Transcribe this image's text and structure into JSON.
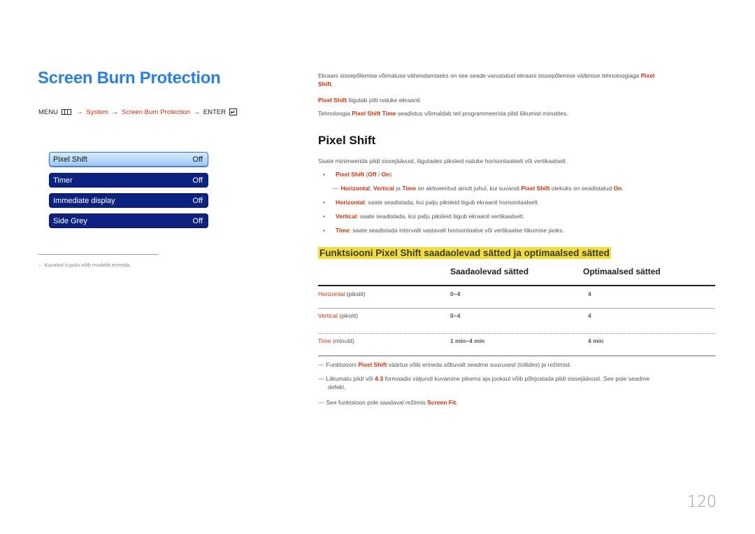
{
  "section_title": "Screen Burn Protection",
  "menu_path": {
    "menu_label": "MENU",
    "items": [
      "System",
      "Screen Burn Protection"
    ],
    "enter_label": "ENTER",
    "arrow": "→"
  },
  "osd_menu": [
    {
      "label": "Pixel Shift",
      "value": "Off",
      "selected": true
    },
    {
      "label": "Timer",
      "value": "Off",
      "selected": false
    },
    {
      "label": "Immediate display",
      "value": "Off",
      "selected": false
    },
    {
      "label": "Side Grey",
      "value": "Off",
      "selected": false
    }
  ],
  "left_footnote": "Kuvatud kujutis võib mudeliti erineda.",
  "left_footnote_dash": "–",
  "intro": {
    "p1_text": "Ekraani sissepõlemise võimaluse vähendamiseks on see seade varustatud ekraani sissepõlemise vältimise tehnoloogiaga ",
    "p1_term_a": "Pixel",
    "p1_term_b": "Shift",
    "p1_end": ".",
    "p2_term": "Pixel Shift",
    "p2_text": " liigutab pilti natuke ekraanil.",
    "p3_start": "Tehnoloogia ",
    "p3_term": "Pixel Shift Time",
    "p3_text": " seadistus võimaldab teil programmeerida pildi liikumist minutites."
  },
  "pixel_shift": {
    "heading": "Pixel Shift",
    "description": "Saate minimeerida pildi sissejäävust, liigutades piksleid natuke horisontaalselt või vertikaalselt.",
    "option_term": "Pixel Shift",
    "option_off": "Off",
    "option_on": "On",
    "note": {
      "t1": "Horizontal",
      "sep1": ", ",
      "t2": "Vertical",
      "sep2": " ja ",
      "t3": "Time",
      "text": " on aktiveeritud ainult juhul, kui suvandi ",
      "t4": "Pixel Shift",
      "text2": " olekuks on seadistatud ",
      "t5": "On",
      "end": "."
    },
    "bullets": [
      {
        "term": "Horizontal",
        "text": ": saate seadistada, kui palju piksleid liigub ekraanil horisontaalselt."
      },
      {
        "term": "Vertical",
        "text": ": saate seadistada, kui palju piksleid liigub ekraanil vertikaalselt."
      },
      {
        "term": "Time",
        "text": ": saate seadistada intervalli vastavalt horisontaalse või vertikaalse liikumise jaoks."
      }
    ]
  },
  "settings_table": {
    "title": "Funktsiooni Pixel Shift saadaolevad sätted ja optimaalsed sätted",
    "headers": [
      "",
      "Saadaolevad sätted",
      "Optimaalsed sätted"
    ],
    "rows": [
      {
        "term": "Horizontal",
        "unit": " (pikslit)",
        "available": "0~4",
        "optimal": "4"
      },
      {
        "term": "Vertical",
        "unit": " (pikslit)",
        "available": "0~4",
        "optimal": "4"
      },
      {
        "term": "Time",
        "unit": " (minutit)",
        "available": "1 min~4 min",
        "optimal": "4 min"
      }
    ]
  },
  "notes": [
    {
      "pre": "Funktsiooni ",
      "term": "Pixel Shift",
      "post": " väärtus võib erineda sõltuvalt seadme suurusest (tollides) ja režiimist."
    },
    {
      "pre": "Liikumatu pildi või ",
      "term": "4:3",
      "post": " formaadis väljundi kuvamine pikema aja jooksul võib põhjustada pildi sissejäävust. See pole seadme",
      "post2": "defekt."
    },
    {
      "pre": "See funktsioon pole saadaval režiimis ",
      "term": "Screen Fit",
      "post": "."
    }
  ],
  "page_number": "120",
  "colors": {
    "title_blue": "#2b7fe0",
    "term_red": "#c8320f",
    "highlight_yellow": "#f3dd3c",
    "osd_navy": "#0d2180"
  }
}
